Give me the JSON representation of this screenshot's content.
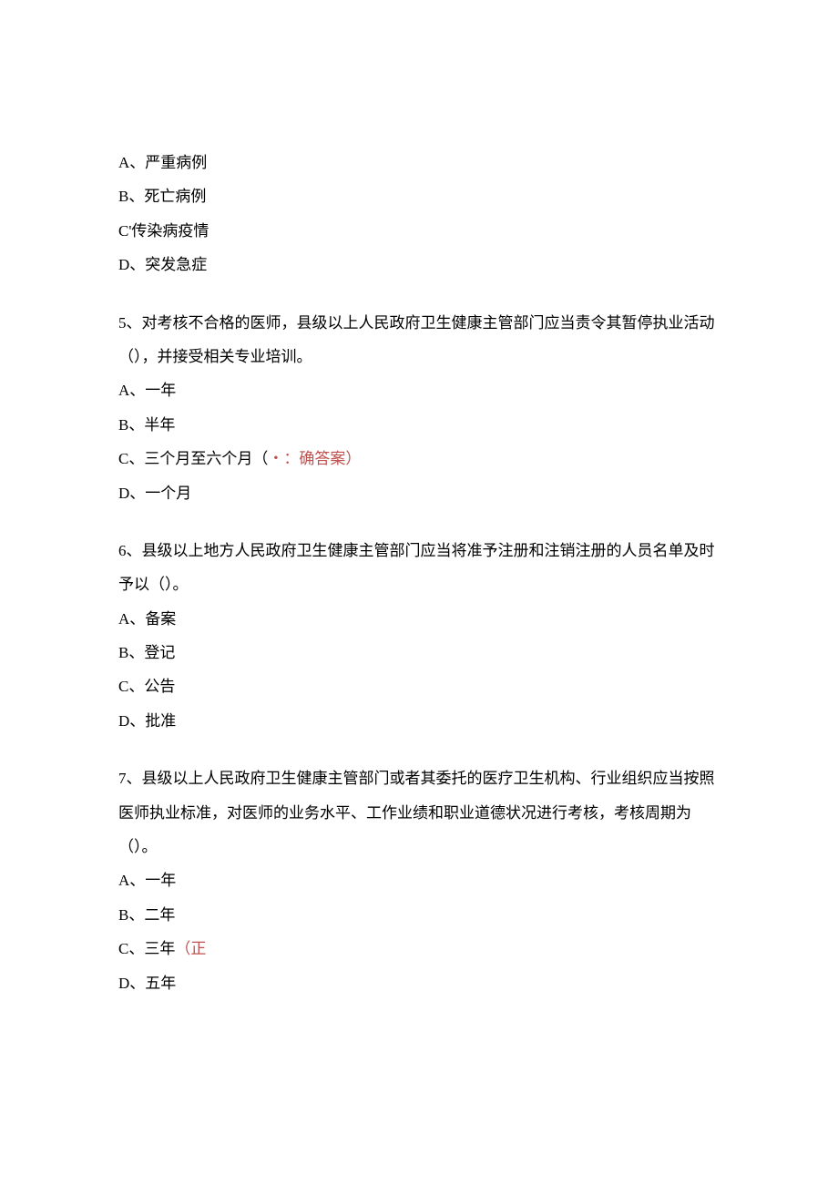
{
  "q4": {
    "optA": "A、严重病例",
    "optB": "B、死亡病例",
    "optC": "C'传染病疫情",
    "optD": "D、突发急症"
  },
  "q5": {
    "stem": "5、对考核不合格的医师，县级以上人民政府卫生健康主管部门应当责令其暂停执业活动（），并接受相关专业培训。",
    "optA": "A、一年",
    "optB": "B、半年",
    "optC_prefix": "C、三个月至六个月（",
    "optC_answer": "・：确答案）",
    "optD": "D、一个月"
  },
  "q6": {
    "stem": "6、县级以上地方人民政府卫生健康主管部门应当将准予注册和注销注册的人员名单及时予以（）。",
    "optA": "A、备案",
    "optB": "B、登记",
    "optC": "C、公告",
    "optD": "D、批准"
  },
  "q7": {
    "stem": "7、县级以上人民政府卫生健康主管部门或者其委托的医疗卫生机构、行业组织应当按照医师执业标准，对医师的业务水平、工作业绩和职业道德状况进行考核，考核周期为（）。",
    "optA": "A、一年",
    "optB": "B、二年",
    "optC_prefix": "C、三年",
    "optC_answer": "（正",
    "optD": "D、五年"
  }
}
